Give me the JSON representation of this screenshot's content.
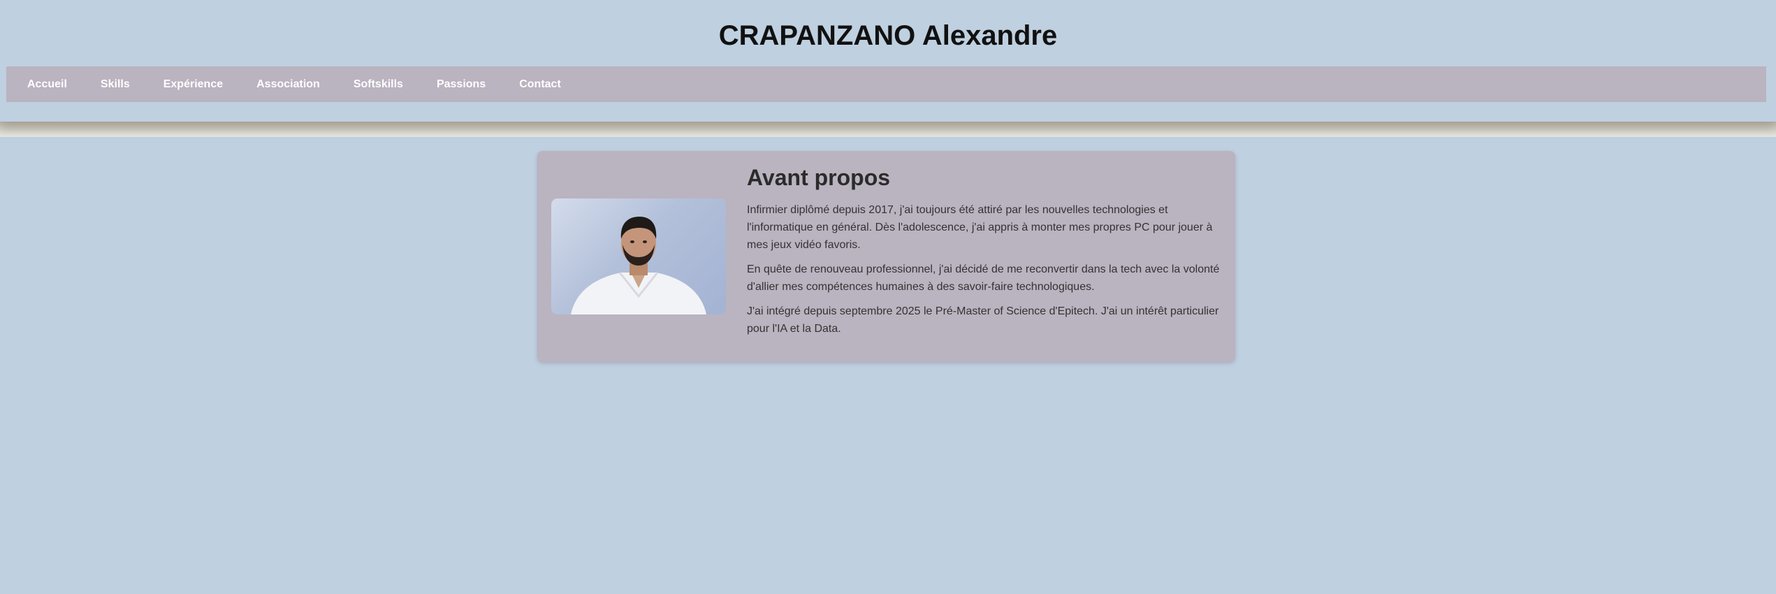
{
  "header": {
    "title": "CRAPANZANO Alexandre"
  },
  "nav": {
    "items": [
      {
        "label": "Accueil"
      },
      {
        "label": "Skills"
      },
      {
        "label": "Expérience"
      },
      {
        "label": "Association"
      },
      {
        "label": "Softskills"
      },
      {
        "label": "Passions"
      },
      {
        "label": "Contact"
      }
    ]
  },
  "about": {
    "heading": "Avant propos",
    "paragraphs": [
      "Infirmier diplômé depuis 2017, j'ai toujours été attiré par les nouvelles technologies et l'informatique en général. Dès l'adolescence, j'ai appris à monter mes propres PC pour jouer à mes jeux vidéo favoris.",
      "En quête de renouveau professionnel, j'ai décidé de me reconvertir dans la tech avec la volonté d'allier mes compétences humaines à des savoir-faire technologiques.",
      "J'ai intégré depuis septembre 2025 le Pré-Master of Science d'Epitech. J'ai un intérêt particulier pour l'IA et la Data."
    ]
  },
  "colors": {
    "page_background": "#bfd0e0",
    "nav_background": "#bab3c0",
    "card_background": "#bab3c0",
    "nav_text": "#ffffff",
    "title_text": "#111111"
  }
}
